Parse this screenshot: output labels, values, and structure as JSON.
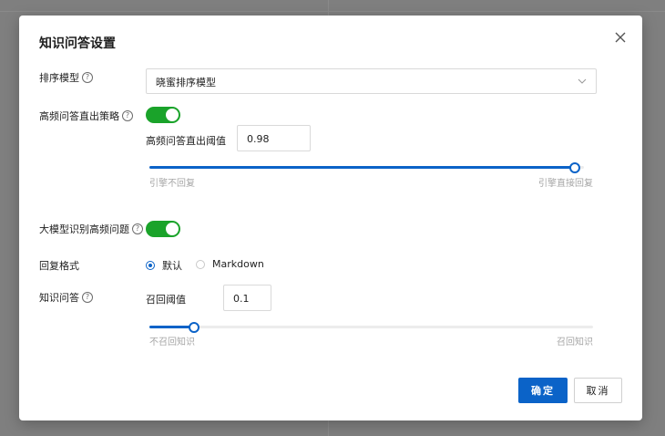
{
  "dialog": {
    "title": "知识问答设置",
    "sort_model": {
      "label": "排序模型",
      "selected": "晓蜜排序模型"
    },
    "high_freq_strategy": {
      "label": "高频问答直出策略",
      "enabled": true,
      "threshold_label": "高频问答直出阈值",
      "threshold_value": "0.98",
      "slider_fraction": 0.98,
      "min_label": "引擎不回复",
      "max_label": "引擎直接回复"
    },
    "llm_high_freq": {
      "label": "大模型识别高频问题",
      "enabled": true
    },
    "reply_format": {
      "label": "回复格式",
      "options": [
        "默认",
        "Markdown"
      ],
      "selected": "默认"
    },
    "knowledge_qa": {
      "label": "知识问答",
      "recall_label": "召回阈值",
      "recall_value": "0.1",
      "slider_fraction": 0.1,
      "min_label": "不召回知识",
      "max_label": "召回知识"
    },
    "buttons": {
      "confirm": "确定",
      "cancel": "取消"
    }
  },
  "colors": {
    "primary": "#0b63c8",
    "switch_on": "#1aa32a",
    "overlay": "#7f7f7f"
  }
}
